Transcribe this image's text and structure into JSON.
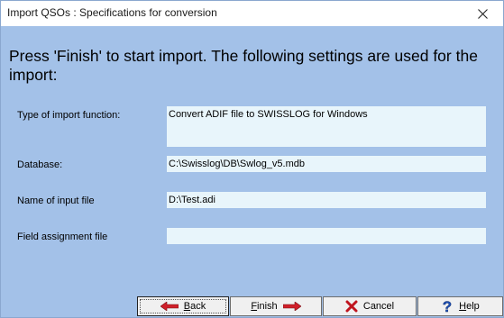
{
  "window": {
    "title": "Import QSOs : Specifications for conversion"
  },
  "headline": "Press 'Finish' to start import. The following settings are used for the import:",
  "fields": [
    {
      "label": "Type of import function:",
      "value": "Convert ADIF file to SWISSLOG for Windows"
    },
    {
      "label": "Database:",
      "value": "C:\\Swisslog\\DB\\Swlog_v5.mdb"
    },
    {
      "label": "Name of input file",
      "value": "D:\\Test.adi"
    },
    {
      "label": "Field assignment file",
      "value": ""
    }
  ],
  "buttons": {
    "back": {
      "mnemonic": "B",
      "rest": "ack"
    },
    "finish": {
      "mnemonic": "F",
      "rest": "inish"
    },
    "cancel": {
      "label": "Cancel"
    },
    "help": {
      "mnemonic": "H",
      "rest": "elp"
    }
  },
  "colors": {
    "background": "#a3c1e8",
    "field": "#e8f5fb",
    "arrow_red": "#d0202a",
    "cancel_x": "#c0141e",
    "help_q": "#1e4fb4"
  },
  "icons": {
    "close": "close-icon",
    "back": "arrow-left-icon",
    "finish": "arrow-right-icon",
    "cancel": "x-icon",
    "help": "question-icon"
  }
}
